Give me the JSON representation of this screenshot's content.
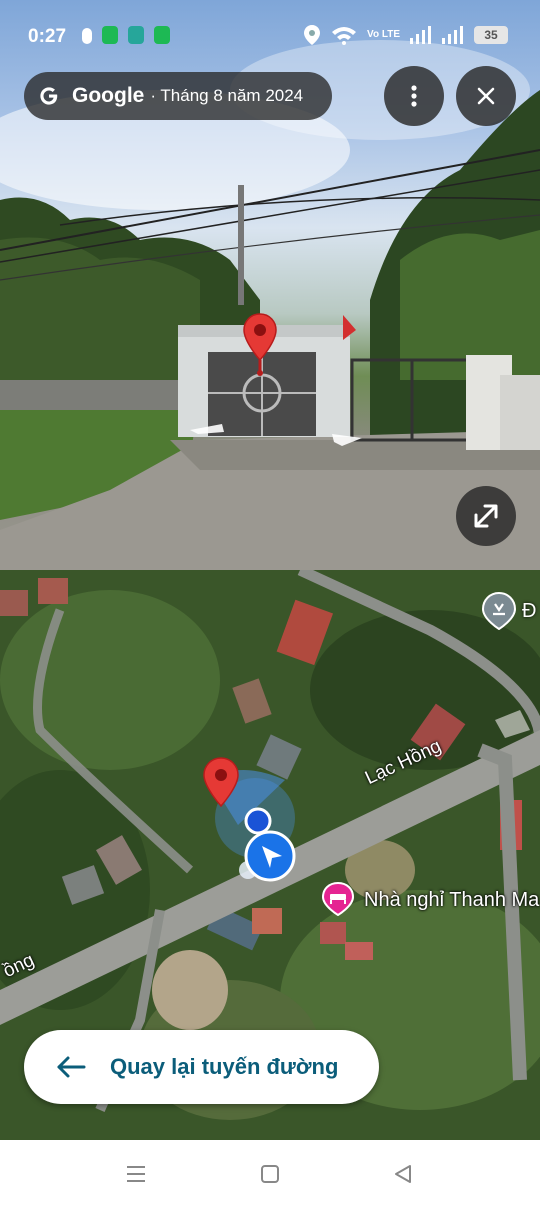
{
  "status_bar": {
    "time": "0:27",
    "battery": "35",
    "network_label": "Vo LTE"
  },
  "street_view": {
    "brand": "Google",
    "date": "· Tháng 8 năm 2024",
    "icons": {
      "more": "more-vert-icon",
      "close": "close-icon",
      "expand": "expand-icon",
      "pin": "location-pin-icon"
    },
    "colors": {
      "pill_bg": "#282828",
      "pin": "#e53935"
    }
  },
  "map": {
    "roads": {
      "main": "Lạc Hồng",
      "partial": "ồng"
    },
    "poi": {
      "name": "Nhà nghỉ Thanh Ma",
      "icon": "hotel-bed-icon",
      "color": "#e52592"
    },
    "poi2": {
      "name": "Đ",
      "icon": "landmark-icon"
    },
    "back_route_label": "Quay lại tuyến đường",
    "colors": {
      "route_accent": "#0b5d7a",
      "location_blue": "#1a73e8"
    }
  },
  "navbar": {
    "icons": {
      "menu": "menu-icon",
      "home": "home-icon",
      "back": "back-icon"
    }
  }
}
